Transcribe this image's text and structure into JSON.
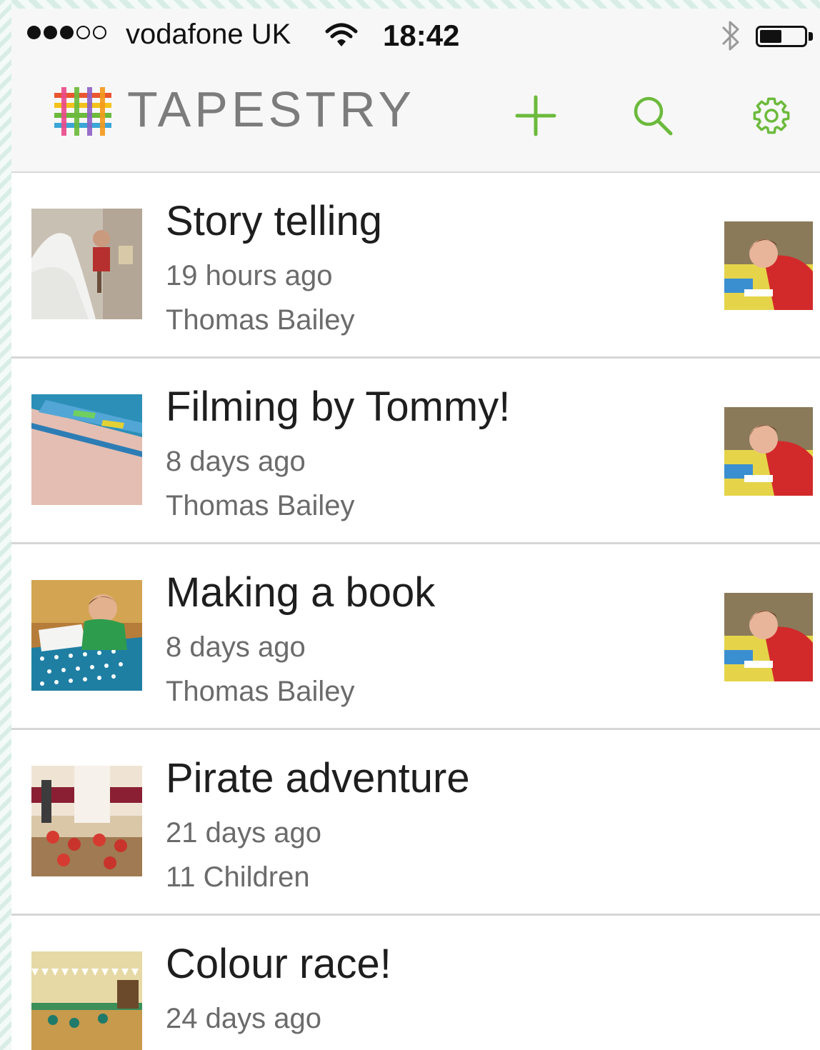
{
  "status_bar": {
    "signal_bars_filled": 3,
    "signal_bars_total": 5,
    "carrier": "vodafone UK",
    "time": "18:42",
    "battery_level": 0.5
  },
  "header": {
    "app_name": "TAPESTRY",
    "add_icon": "plus-icon",
    "search_icon": "search-icon",
    "settings_icon": "gear-icon",
    "accent_color": "#6cba3c"
  },
  "observations": [
    {
      "title": "Story telling",
      "time": "19 hours ago",
      "author": "Thomas Bailey",
      "has_child_photo": true
    },
    {
      "title": "Filming by Tommy!",
      "time": "8 days ago",
      "author": "Thomas Bailey",
      "has_child_photo": true
    },
    {
      "title": "Making a book",
      "time": "8 days ago",
      "author": "Thomas Bailey",
      "has_child_photo": true
    },
    {
      "title": "Pirate adventure",
      "time": "21 days ago",
      "author": "11 Children",
      "has_child_photo": false
    },
    {
      "title": "Colour race!",
      "time": "24 days ago",
      "author": "",
      "has_child_photo": false
    }
  ]
}
